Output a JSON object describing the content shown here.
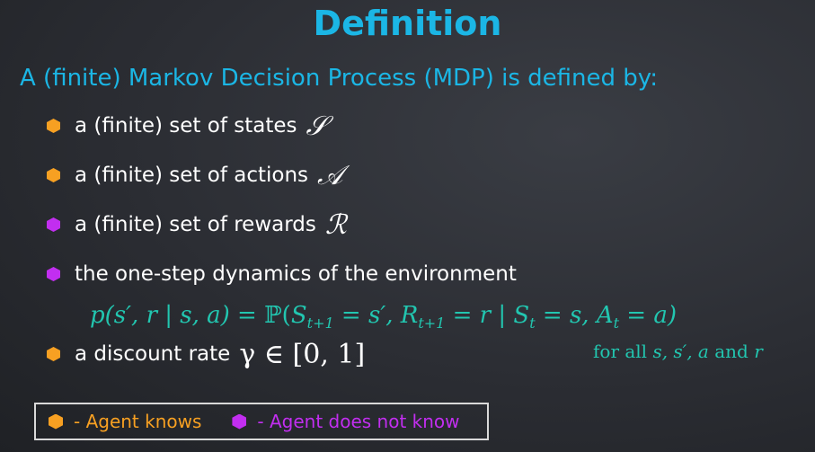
{
  "slide": {
    "title": "Definition",
    "intro": "A (finite) Markov Decision Process (MDP) is defined by:"
  },
  "bullets": [
    {
      "text": "a (finite) set of states",
      "symbol": "𝒮",
      "color": "#f7a022",
      "known": "agent-knows"
    },
    {
      "text": "a (finite) set of actions",
      "symbol": "𝒜",
      "color": "#f7a022",
      "known": "agent-knows"
    },
    {
      "text": "a (finite) set of rewards",
      "symbol": "ℛ",
      "color": "#c22ef0",
      "known": "agent-does-not-know"
    },
    {
      "text": "the one-step dynamics of the environment",
      "color": "#c22ef0",
      "known": "agent-does-not-know"
    },
    {
      "text": "a discount rate",
      "symbol": "γ ∈ [0, 1]",
      "color": "#f7a022",
      "known": "agent-knows"
    }
  ],
  "formula": {
    "lhs": "p(s′, r | s, a)",
    "eq": " = ",
    "prob": "ℙ(",
    "S": "S",
    "S_sub": "t+1",
    "eq_s": " = s′, ",
    "R": "R",
    "R_sub": "t+1",
    "eq_r": " = r | ",
    "St": "S",
    "St_sub": "t",
    "eq_st": " = s, ",
    "At": "A",
    "At_sub": "t",
    "eq_at": " = a)"
  },
  "forall": {
    "prefix": "for all ",
    "vars": "s, s′, a",
    "and": " and ",
    "last": "r"
  },
  "legend": {
    "knows": "- Agent knows",
    "not_knows": "- Agent does not know",
    "orange": "#f7a022",
    "purple": "#c22ef0"
  },
  "colors": {
    "title": "#1bb6e5",
    "formula": "#22c6b0"
  }
}
